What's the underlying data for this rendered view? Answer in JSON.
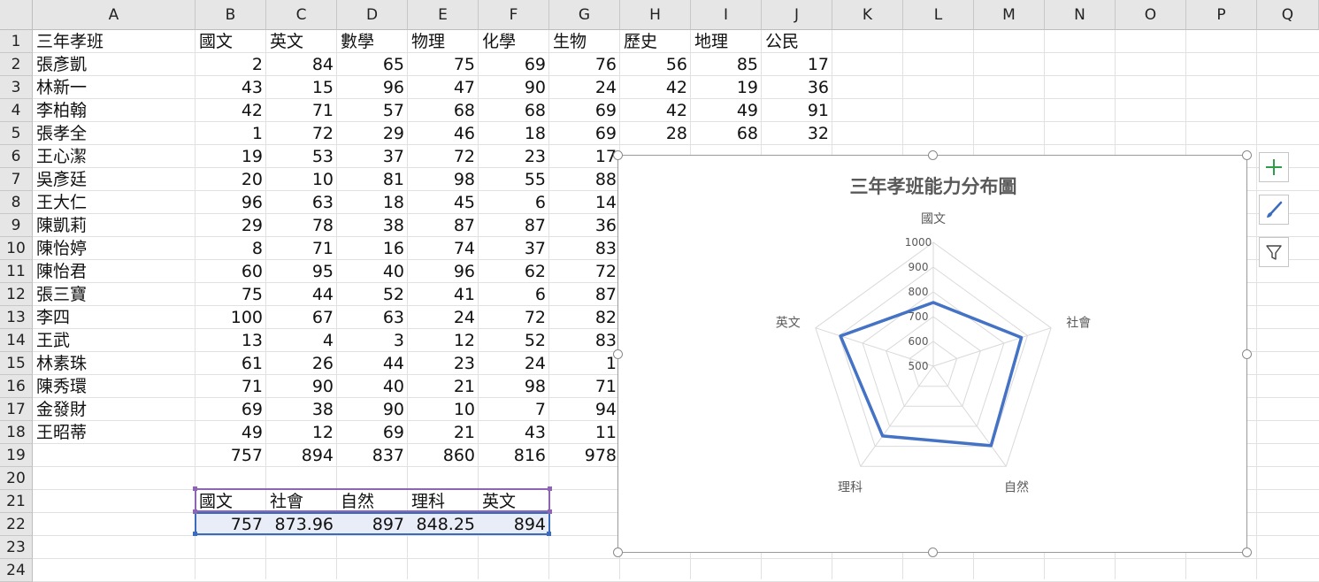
{
  "columns": [
    "A",
    "B",
    "C",
    "D",
    "E",
    "F",
    "G",
    "H",
    "I",
    "J",
    "K",
    "L",
    "M",
    "N",
    "O",
    "P",
    "Q"
  ],
  "rows": [
    "1",
    "2",
    "3",
    "4",
    "5",
    "6",
    "7",
    "8",
    "9",
    "10",
    "11",
    "12",
    "13",
    "14",
    "15",
    "16",
    "17",
    "18",
    "19",
    "20",
    "21",
    "22",
    "23",
    "24"
  ],
  "sheet": {
    "header_row": [
      "三年孝班",
      "國文",
      "英文",
      "數學",
      "物理",
      "化學",
      "生物",
      "歷史",
      "地理",
      "公民"
    ],
    "students": [
      {
        "name": "張彥凱",
        "scores": [
          "2",
          "84",
          "65",
          "75",
          "69",
          "76",
          "56",
          "85",
          "17"
        ]
      },
      {
        "name": "林新一",
        "scores": [
          "43",
          "15",
          "96",
          "47",
          "90",
          "24",
          "42",
          "19",
          "36"
        ]
      },
      {
        "name": "李柏翰",
        "scores": [
          "42",
          "71",
          "57",
          "68",
          "68",
          "69",
          "42",
          "49",
          "91"
        ]
      },
      {
        "name": "張孝全",
        "scores": [
          "1",
          "72",
          "29",
          "46",
          "18",
          "69",
          "28",
          "68",
          "32"
        ]
      },
      {
        "name": "王心潔",
        "scores": [
          "19",
          "53",
          "37",
          "72",
          "23",
          "17"
        ]
      },
      {
        "name": "吳彥廷",
        "scores": [
          "20",
          "10",
          "81",
          "98",
          "55",
          "88"
        ]
      },
      {
        "name": "王大仁",
        "scores": [
          "96",
          "63",
          "18",
          "45",
          "6",
          "14"
        ]
      },
      {
        "name": "陳凱莉",
        "scores": [
          "29",
          "78",
          "38",
          "87",
          "87",
          "36"
        ]
      },
      {
        "name": "陳怡婷",
        "scores": [
          "8",
          "71",
          "16",
          "74",
          "37",
          "83"
        ]
      },
      {
        "name": "陳怡君",
        "scores": [
          "60",
          "95",
          "40",
          "96",
          "62",
          "72"
        ]
      },
      {
        "name": "張三寶",
        "scores": [
          "75",
          "44",
          "52",
          "41",
          "6",
          "87"
        ]
      },
      {
        "name": "李四",
        "scores": [
          "100",
          "67",
          "63",
          "24",
          "72",
          "82"
        ]
      },
      {
        "name": "王武",
        "scores": [
          "13",
          "4",
          "3",
          "12",
          "52",
          "83"
        ]
      },
      {
        "name": "林素珠",
        "scores": [
          "61",
          "26",
          "44",
          "23",
          "24",
          "1"
        ]
      },
      {
        "name": "陳秀環",
        "scores": [
          "71",
          "90",
          "40",
          "21",
          "98",
          "71"
        ]
      },
      {
        "name": "金發財",
        "scores": [
          "69",
          "38",
          "90",
          "10",
          "7",
          "94"
        ]
      },
      {
        "name": "王昭蒂",
        "scores": [
          "49",
          "12",
          "69",
          "21",
          "43",
          "11"
        ]
      }
    ],
    "totals": [
      "757",
      "894",
      "837",
      "860",
      "816",
      "978"
    ],
    "summary_headers": [
      "國文",
      "社會",
      "自然",
      "理科",
      "英文"
    ],
    "summary_values": [
      "757",
      "873.96",
      "897",
      "848.25",
      "894"
    ]
  },
  "chart_data": {
    "type": "radar",
    "title": "三年孝班能力分布圖",
    "categories": [
      "國文",
      "社會",
      "自然",
      "理科",
      "英文"
    ],
    "values": [
      757,
      873.96,
      897,
      848.25,
      894
    ],
    "rmin": 500,
    "rmax": 1000,
    "ticks": [
      500,
      600,
      700,
      800,
      900,
      1000
    ],
    "tick_labels": [
      "500",
      "600",
      "700",
      "800",
      "900",
      "1000"
    ],
    "grid": true,
    "legend": "none",
    "line_color": "#4472c4",
    "grid_color": "#d9d9d9"
  }
}
